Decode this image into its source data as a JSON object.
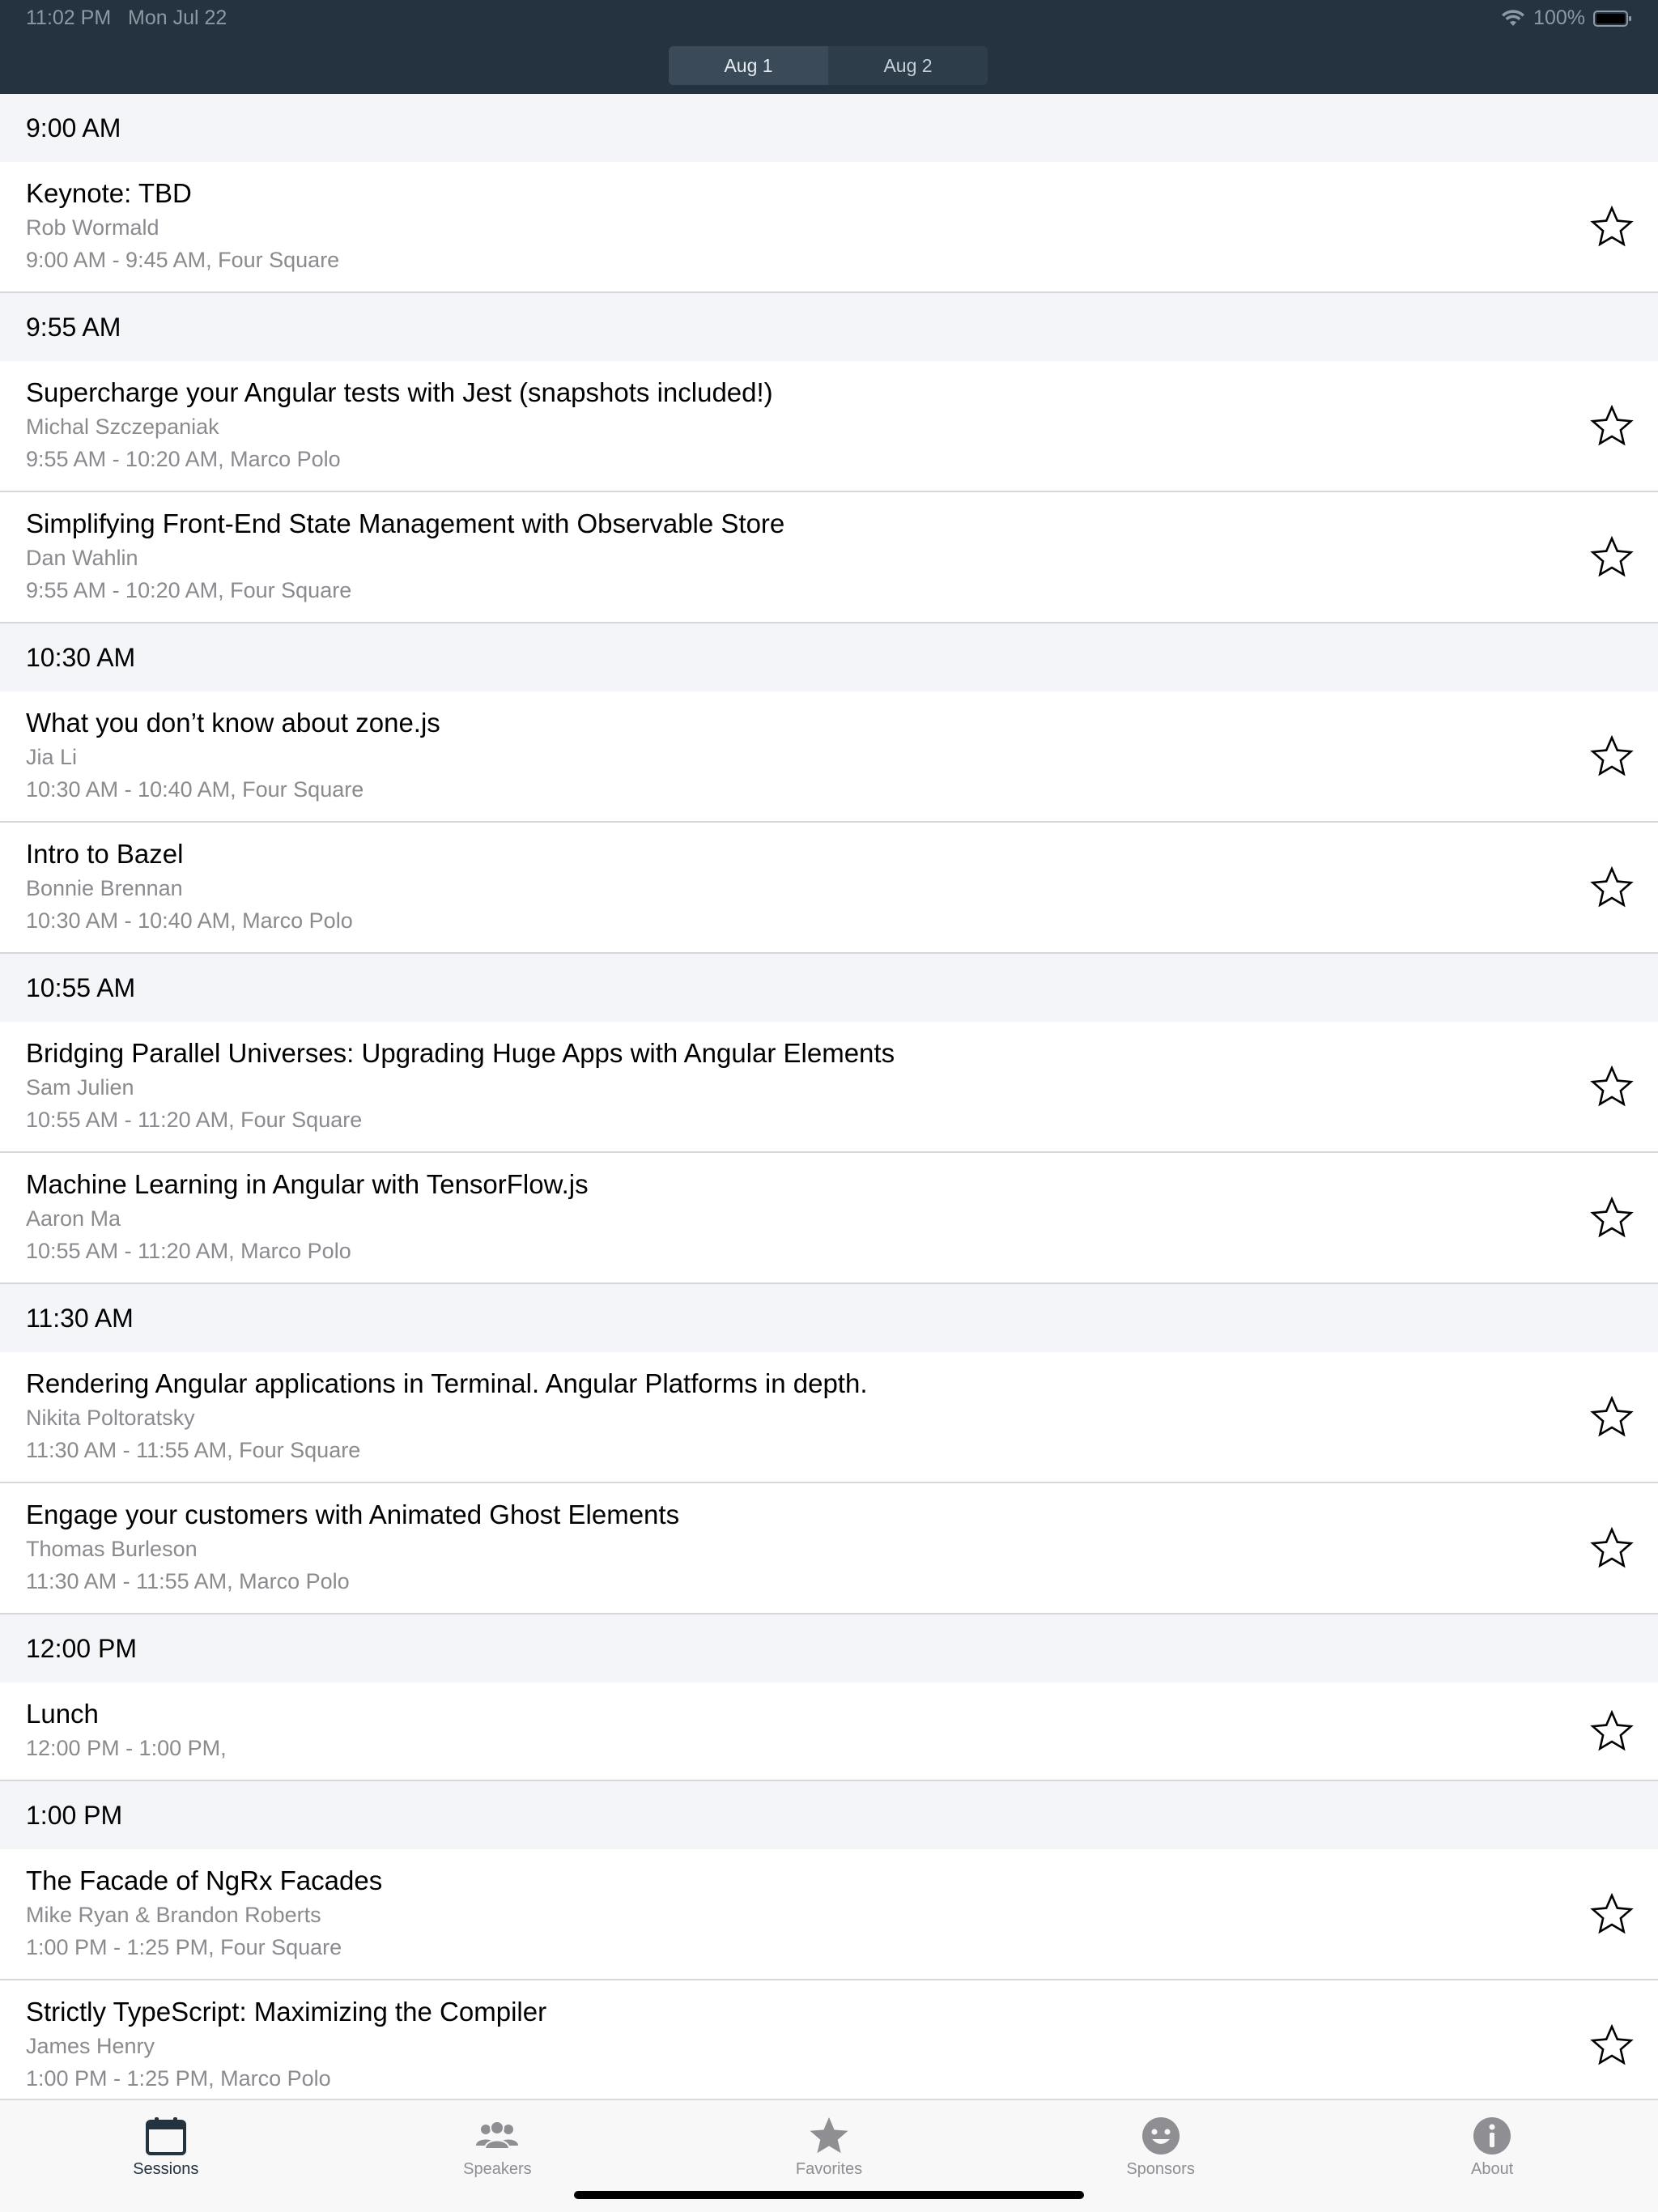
{
  "status_bar": {
    "time": "11:02 PM",
    "date": "Mon Jul 22",
    "battery": "100%"
  },
  "segment": {
    "tabs": [
      {
        "label": "Aug 1",
        "active": true
      },
      {
        "label": "Aug 2",
        "active": false
      }
    ]
  },
  "schedule": [
    {
      "time": "9:00 AM",
      "sessions": [
        {
          "title": "Keynote: TBD",
          "speaker": "Rob Wormald",
          "time": "9:00 AM - 9:45 AM, Four Square"
        }
      ]
    },
    {
      "time": "9:55 AM",
      "sessions": [
        {
          "title": "Supercharge your Angular tests with Jest (snapshots included!)",
          "speaker": "Michal Szczepaniak",
          "time": "9:55 AM - 10:20 AM, Marco Polo"
        },
        {
          "title": "Simplifying Front-End State Management with Observable Store",
          "speaker": "Dan Wahlin",
          "time": "9:55 AM - 10:20 AM, Four Square"
        }
      ]
    },
    {
      "time": "10:30 AM",
      "sessions": [
        {
          "title": "What you don’t know about zone.js",
          "speaker": "Jia Li",
          "time": "10:30 AM - 10:40 AM, Four Square"
        },
        {
          "title": "Intro to Bazel",
          "speaker": "Bonnie Brennan",
          "time": "10:30 AM - 10:40 AM, Marco Polo"
        }
      ]
    },
    {
      "time": "10:55 AM",
      "sessions": [
        {
          "title": "Bridging Parallel Universes: Upgrading Huge Apps with Angular Elements",
          "speaker": "Sam Julien",
          "time": "10:55 AM - 11:20 AM, Four Square"
        },
        {
          "title": "Machine Learning in Angular with TensorFlow.js",
          "speaker": "Aaron Ma",
          "time": "10:55 AM - 11:20 AM, Marco Polo"
        }
      ]
    },
    {
      "time": "11:30 AM",
      "sessions": [
        {
          "title": "Rendering Angular applications in Terminal. Angular Platforms in depth.",
          "speaker": "Nikita Poltoratsky",
          "time": "11:30 AM - 11:55 AM, Four Square"
        },
        {
          "title": "Engage your customers with Animated Ghost Elements",
          "speaker": "Thomas Burleson",
          "time": "11:30 AM - 11:55 AM, Marco Polo"
        }
      ]
    },
    {
      "time": "12:00 PM",
      "sessions": [
        {
          "title": "Lunch",
          "speaker": "",
          "time": "12:00 PM - 1:00 PM,"
        }
      ]
    },
    {
      "time": "1:00 PM",
      "sessions": [
        {
          "title": "The Facade of NgRx Facades",
          "speaker": "Mike Ryan & Brandon Roberts",
          "time": "1:00 PM - 1:25 PM, Four Square"
        },
        {
          "title": "Strictly TypeScript: Maximizing the Compiler",
          "speaker": "James Henry",
          "time": "1:00 PM - 1:25 PM, Marco Polo"
        }
      ]
    }
  ],
  "tabbar": {
    "tabs": [
      {
        "label": "Sessions",
        "icon": "calendar-icon",
        "active": true
      },
      {
        "label": "Speakers",
        "icon": "people-icon",
        "active": false
      },
      {
        "label": "Favorites",
        "icon": "star-icon",
        "active": false
      },
      {
        "label": "Sponsors",
        "icon": "smiley-icon",
        "active": false
      },
      {
        "label": "About",
        "icon": "info-icon",
        "active": false
      }
    ]
  },
  "colors": {
    "header_bg": "#253340",
    "group_header_bg": "#f4f5f8",
    "secondary_text": "#8a8a8f",
    "tab_active": "#243340",
    "tab_inactive": "#8e8e93"
  }
}
